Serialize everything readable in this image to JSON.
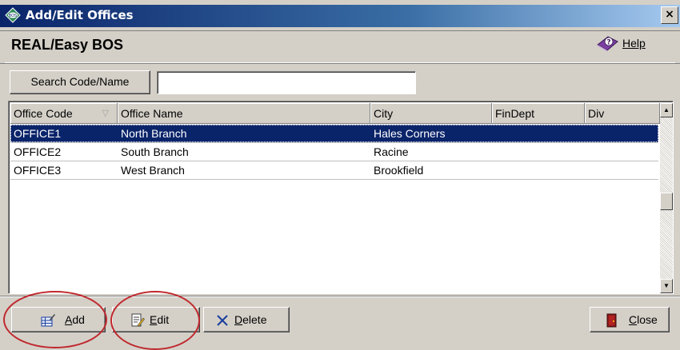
{
  "window": {
    "title": "Add/Edit Offices",
    "close_glyph": "×"
  },
  "header": {
    "app_title": "REAL/Easy BOS",
    "help_label": "Help"
  },
  "search": {
    "button_label": "Search Code/Name",
    "input_value": ""
  },
  "grid": {
    "columns": [
      "Office Code",
      "Office Name",
      "City",
      "FinDept",
      "Div"
    ],
    "sort_indicator": "▽",
    "rows": [
      {
        "code": "OFFICE1",
        "name": "North Branch",
        "city": "Hales Corners",
        "findept": "",
        "div": "",
        "selected": true
      },
      {
        "code": "OFFICE2",
        "name": "South Branch",
        "city": "Racine",
        "findept": "",
        "div": "",
        "selected": false
      },
      {
        "code": "OFFICE3",
        "name": "West Branch",
        "city": "Brookfield",
        "findept": "",
        "div": "",
        "selected": false
      }
    ]
  },
  "buttons": {
    "add": "Add",
    "edit": "Edit",
    "delete": "Delete",
    "close": "Close"
  },
  "icons": {
    "app": "bos-logo-icon",
    "help": "help-book-icon",
    "add": "add-record-icon",
    "edit": "edit-document-icon",
    "delete": "delete-x-icon",
    "close": "door-exit-icon"
  },
  "colors": {
    "title_gradient_start": "#0a246a",
    "title_gradient_end": "#a6caf0",
    "selection": "#0a246a",
    "annotation_circle": "#c0282d",
    "delete_x": "#1a3d9e"
  }
}
